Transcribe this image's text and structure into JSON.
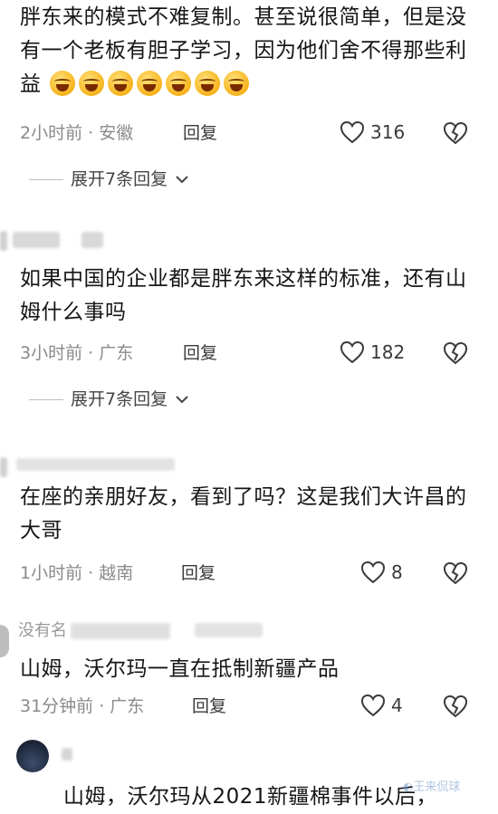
{
  "comments": [
    {
      "text": "胖东来的模式不难复制。甚至说很简单，但是没有一个老板有胆子学习，因为他们舍不得那些利益",
      "meta": "2小时前 · 安徽",
      "reply_label": "回复",
      "likes": "316",
      "expand_label": "展开7条回复"
    },
    {
      "text": "如果中国的企业都是胖东来这样的标准，还有山姆什么事吗",
      "meta": "3小时前 · 广东",
      "reply_label": "回复",
      "likes": "182",
      "expand_label": "展开7条回复"
    },
    {
      "text": "在座的亲朋好友，看到了吗？这是我们大许昌的大哥",
      "meta": "1小时前 · 越南",
      "reply_label": "回复",
      "likes": "8"
    },
    {
      "username_partial": "没有名",
      "text": "山姆，沃尔玛一直在抵制新疆产品",
      "meta": "31分钟前 · 广东",
      "reply_label": "回复",
      "likes": "4"
    },
    {
      "text_partial": "山姆，沃尔玛从2021新疆棉事件以后，"
    }
  ],
  "emoji_count": 7,
  "watermark": "王来侃球",
  "icons": {
    "like": "heart-icon",
    "dislike": "broken-heart-icon",
    "expand": "chevron-down-icon"
  }
}
